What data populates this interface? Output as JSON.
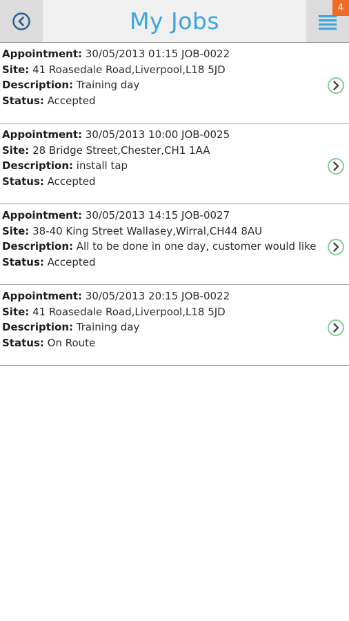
{
  "header": {
    "title": "My Jobs",
    "badge_count": "4",
    "accent_color": "#3aa6dc",
    "badge_color": "#ef6a23",
    "back_icon": "back-circle-icon",
    "menu_icon": "hamburger-menu-icon"
  },
  "labels": {
    "appointment": "Appointment:",
    "site": "Site:",
    "description": "Description:",
    "status": "Status:"
  },
  "jobs": [
    {
      "appointment": "30/05/2013 01:15 JOB-0022",
      "site": "41 Roasedale Road,Liverpool,L18 5JD",
      "description": "Training day",
      "status": "Accepted"
    },
    {
      "appointment": "30/05/2013 10:00 JOB-0025",
      "site": "28 Bridge Street,Chester,CH1 1AA",
      "description": "install tap",
      "status": "Accepted"
    },
    {
      "appointment": "30/05/2013 14:15 JOB-0027",
      "site": "38-40 King Street Wallasey,Wirral,CH44 8AU",
      "description": "All to be done in one day, customer would like notific",
      "status": "Accepted"
    },
    {
      "appointment": "30/05/2013 20:15 JOB-0022",
      "site": "41 Roasedale Road,Liverpool,L18 5JD",
      "description": "Training day",
      "status": "On Route"
    }
  ]
}
